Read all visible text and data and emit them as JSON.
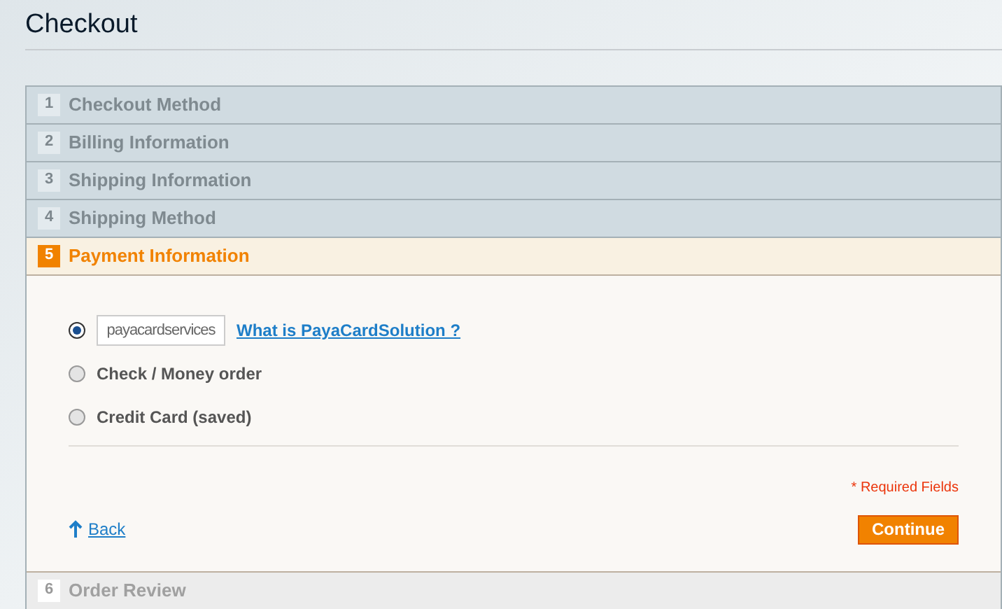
{
  "title": "Checkout",
  "steps": [
    {
      "number": "1",
      "label": "Checkout Method",
      "kind": "done"
    },
    {
      "number": "2",
      "label": "Billing Information",
      "kind": "done"
    },
    {
      "number": "3",
      "label": "Shipping Information",
      "kind": "done"
    },
    {
      "number": "4",
      "label": "Shipping Method",
      "kind": "done"
    },
    {
      "number": "5",
      "label": "Payment Information",
      "kind": "active"
    },
    {
      "number": "6",
      "label": "Order Review",
      "kind": "pending"
    }
  ],
  "payment_methods": [
    {
      "kind": "logo",
      "logo_text": "payacardservices",
      "link": "What is PayaCardSolution ?",
      "selected": true
    },
    {
      "kind": "text",
      "label": "Check / Money order",
      "selected": false
    },
    {
      "kind": "text",
      "label": "Credit Card (saved)",
      "selected": false
    }
  ],
  "required_note": "* Required Fields",
  "back_link": "Back",
  "continue_button": "Continue"
}
